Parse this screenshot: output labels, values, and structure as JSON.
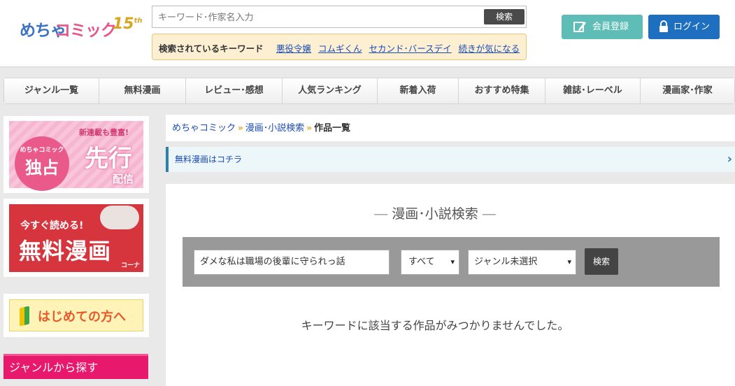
{
  "header": {
    "logo": {
      "part1": "めちゃ",
      "part2": "コミック",
      "anniv": "15",
      "anniv_suffix": "th"
    },
    "search": {
      "placeholder": "キーワード･作家名入力",
      "button": "検索"
    },
    "popular": {
      "title": "検索されているキーワード",
      "keywords": [
        "悪役令嬢",
        "コムギくん",
        "セカンド･バースデイ",
        "続きが気になる"
      ]
    },
    "register_label": "会員登録",
    "login_label": "ログイン",
    "colors": {
      "register": "#5fbdb7",
      "login": "#1e6fbf"
    }
  },
  "nav": {
    "items": [
      "ジャンル一覧",
      "無料漫画",
      "レビュー･感想",
      "人気ランキング",
      "新着入荷",
      "おすすめ特集",
      "雑誌･レーベル",
      "漫画家･作家"
    ]
  },
  "sidebar": {
    "banner1": {
      "tag_small": "めちゃコミック",
      "tag_big": "独占",
      "top": "新連載も豊富!",
      "main": "先行",
      "sub": "配信"
    },
    "banner2": {
      "top": "今すぐ読める!",
      "main": "無料漫画",
      "sub": "コーナー"
    },
    "banner3": {
      "label": "はじめての方へ"
    },
    "genre_heading": "ジャンルから探す"
  },
  "breadcrumb": {
    "items": [
      "めちゃコミック",
      "漫画･小説検索"
    ],
    "current": "作品一覧"
  },
  "free_link": {
    "label": "無料漫画はコチラ"
  },
  "search_panel": {
    "title": "漫画･小説検索",
    "keyword_value": "ダメな私は職場の後輩に守られっ話",
    "scope_selected": "すべて",
    "genre_selected": "ジャンル未選択",
    "button": "検索",
    "no_result": "キーワードに該当する作品がみつかりませんでした。"
  }
}
